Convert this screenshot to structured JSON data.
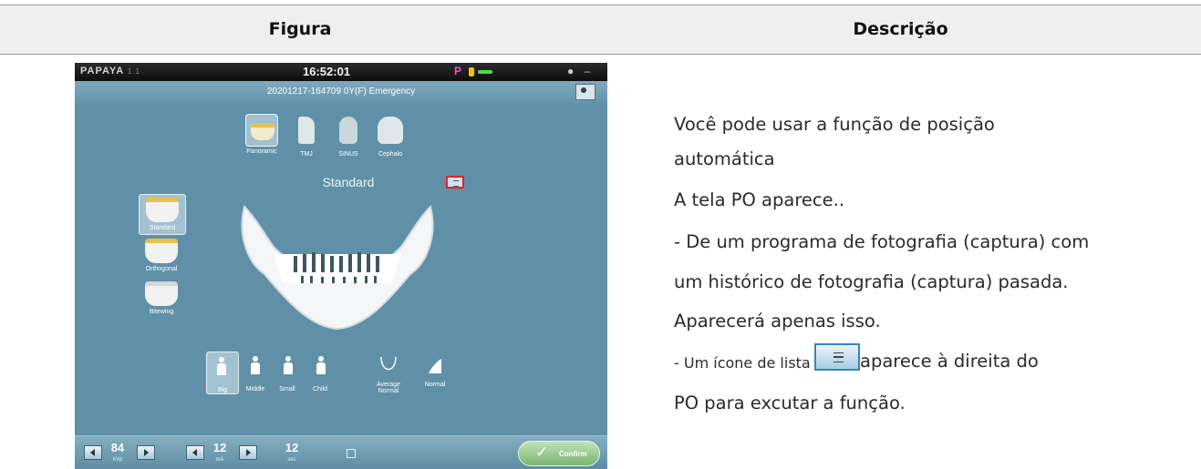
{
  "table": {
    "header_figure": "Figura",
    "header_description": "Descrição"
  },
  "app": {
    "brand": "PAPAYA",
    "brand_version": "1.1",
    "clock": "16:52:01",
    "indicator_p": "P",
    "window_controls": "● – ×",
    "patient_info": "20201217-164709  0Y(F)  Emergency",
    "modes": [
      {
        "label": "Panoramic",
        "icon": "jaw-icon"
      },
      {
        "label": "TMJ",
        "icon": "tmj-icon"
      },
      {
        "label": "SINUS",
        "icon": "sinus-icon"
      },
      {
        "label": "Cephalo",
        "icon": "skull-icon"
      }
    ],
    "program_title": "Standard",
    "side_programs": [
      "Standard",
      "Orthogonal",
      "Bitewing"
    ],
    "sizes": [
      {
        "label": "Big"
      },
      {
        "label": "Middle"
      },
      {
        "label": "Small"
      },
      {
        "label": "Child"
      }
    ],
    "arch_label": "Average Normal",
    "bite_label": "Normal",
    "kvp_value": "84",
    "kvp_unit": "kVp",
    "ma_value": "12",
    "ma_unit": "mA",
    "sec_value": "12",
    "sec_unit": "sec",
    "confirm_label": "Confirm"
  },
  "description": {
    "line1": "Você pode usar a função de posição",
    "line2": "automática",
    "line3": "A tela PO aparece..",
    "line4": "- De um programa de fotografia (captura) com",
    "line5": "um histórico de fotografia (captura) pasada.",
    "line6": "Aparecerá apenas isso.",
    "line7_prefix": "- Um ícone de lista",
    "line7_suffix": "aparece à direita do",
    "line8": "PO para excutar a função."
  }
}
